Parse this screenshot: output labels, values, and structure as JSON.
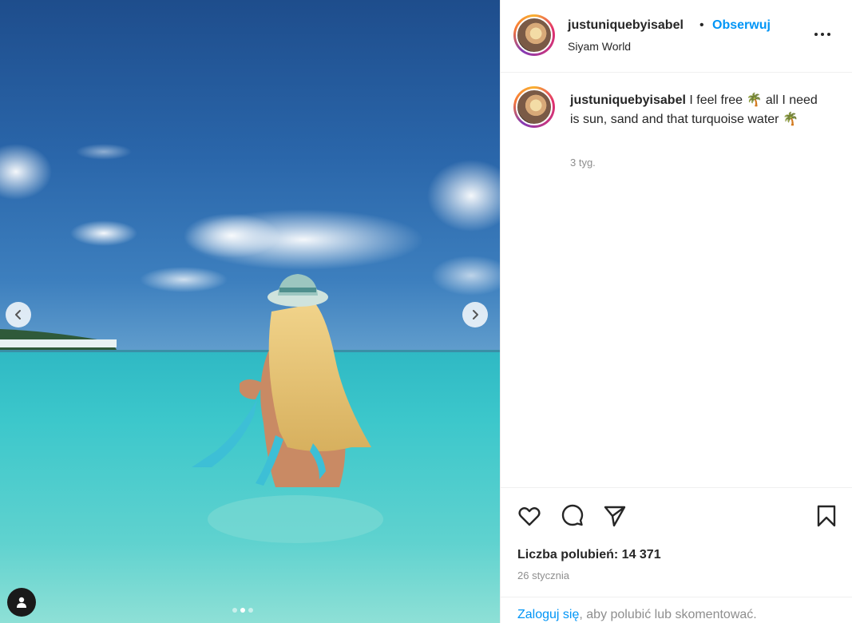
{
  "media": {
    "carousel": {
      "slide_count": 3,
      "active_index": 1
    }
  },
  "post": {
    "author": "justuniquebyisabel",
    "separator": "•",
    "follow_label": "Obserwuj",
    "location": "Siyam World",
    "caption_text": "I feel free 🌴 all I need is sun, sand and that turquoise water 🌴",
    "caption_time": "3 tyg.",
    "likes_text": "Liczba polubień: 14 371",
    "date": "26 stycznia"
  },
  "footer": {
    "login_link": "Zaloguj się",
    "login_rest": ", aby polubić lub skomentować."
  },
  "icons": {
    "like": "heart-icon",
    "comment": "comment-icon",
    "share": "send-icon",
    "save": "bookmark-icon",
    "more": "more-options-icon",
    "prev": "chevron-left-icon",
    "next": "chevron-right-icon",
    "tags": "user-tag-icon"
  },
  "colors": {
    "accent": "#0095f6",
    "text": "#262626",
    "muted": "#8e8e8e",
    "divider": "#efefef"
  }
}
